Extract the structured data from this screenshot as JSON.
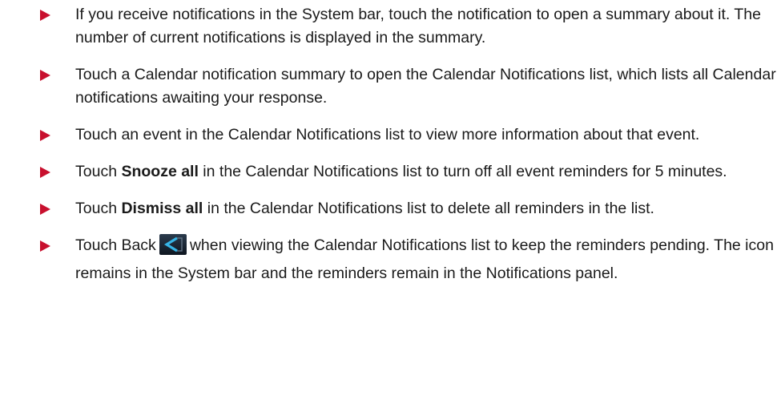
{
  "items": [
    {
      "text": "If you receive notifications in the System bar, touch the notification to open a summary about it. The number of current notifications is displayed in the summary."
    },
    {
      "text": "Touch a Calendar notification summary to open the Calendar Notifications list, which lists all Calendar notifications awaiting your response."
    },
    {
      "text": "Touch an event in the Calendar Notifications list to view more information about that event."
    },
    {
      "pre": "Touch ",
      "bold": "Snooze all",
      "post": " in the Calendar Notifications list to turn off all event reminders for 5 minutes."
    },
    {
      "pre": "Touch ",
      "bold": "Dismiss all",
      "post": " in the Calendar Notifications list to delete all reminders in the list."
    },
    {
      "pre": "Touch Back",
      "icon": "back-button-icon",
      "post": "when viewing the Calendar Notifications list to keep the reminders pending. The icon remains in the System bar and the reminders remain in the Notifications panel."
    }
  ],
  "colors": {
    "bullet": "#c8102e",
    "text": "#1a1a1a",
    "icon_background": "#1c2a3a",
    "icon_accent": "#36b4e6"
  }
}
